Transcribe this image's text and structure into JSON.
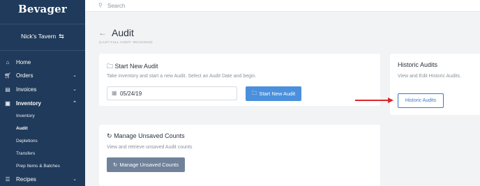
{
  "app": {
    "brand": "Bevager"
  },
  "account": {
    "name": "Nick's Tavern",
    "switch_icon": "swap-icon"
  },
  "sidebar": {
    "items": [
      {
        "label": "Home",
        "icon": "home-icon"
      },
      {
        "label": "Orders",
        "icon": "cart-icon"
      },
      {
        "label": "Invoices",
        "icon": "invoice-icon"
      },
      {
        "label": "Inventory",
        "icon": "box-icon"
      },
      {
        "label": "Recipes",
        "icon": "recipe-icon"
      }
    ],
    "inventory_sub": [
      {
        "label": "Inventory"
      },
      {
        "label": "Audit"
      },
      {
        "label": "Depletions"
      },
      {
        "label": "Transfers"
      },
      {
        "label": "Prep Items & Batches"
      }
    ]
  },
  "search": {
    "placeholder": "Search"
  },
  "page": {
    "title": "Audit",
    "subtitle": "(LAST FULL AUDIT: 05/13/2019)"
  },
  "start_audit": {
    "title": "Start New Audit",
    "description": "Take inventory and start a new Audit. Select an Audit Date and begin.",
    "date_value": "05/24/19",
    "button_label": "Start New Audit"
  },
  "unsaved": {
    "title": "Manage Unsaved Counts",
    "description": "View and retrieve unsaved Audit counts",
    "button_label": "Manage Unsaved Counts"
  },
  "historic": {
    "title": "Historic Audits",
    "description": "View and Edit Historic Audits.",
    "button_label": "Historic Audits"
  },
  "colors": {
    "sidebar": "#1f3a5a",
    "primary": "#4a90dd",
    "secondary_button": "#6f829a",
    "annotation_arrow": "#e0242b"
  }
}
